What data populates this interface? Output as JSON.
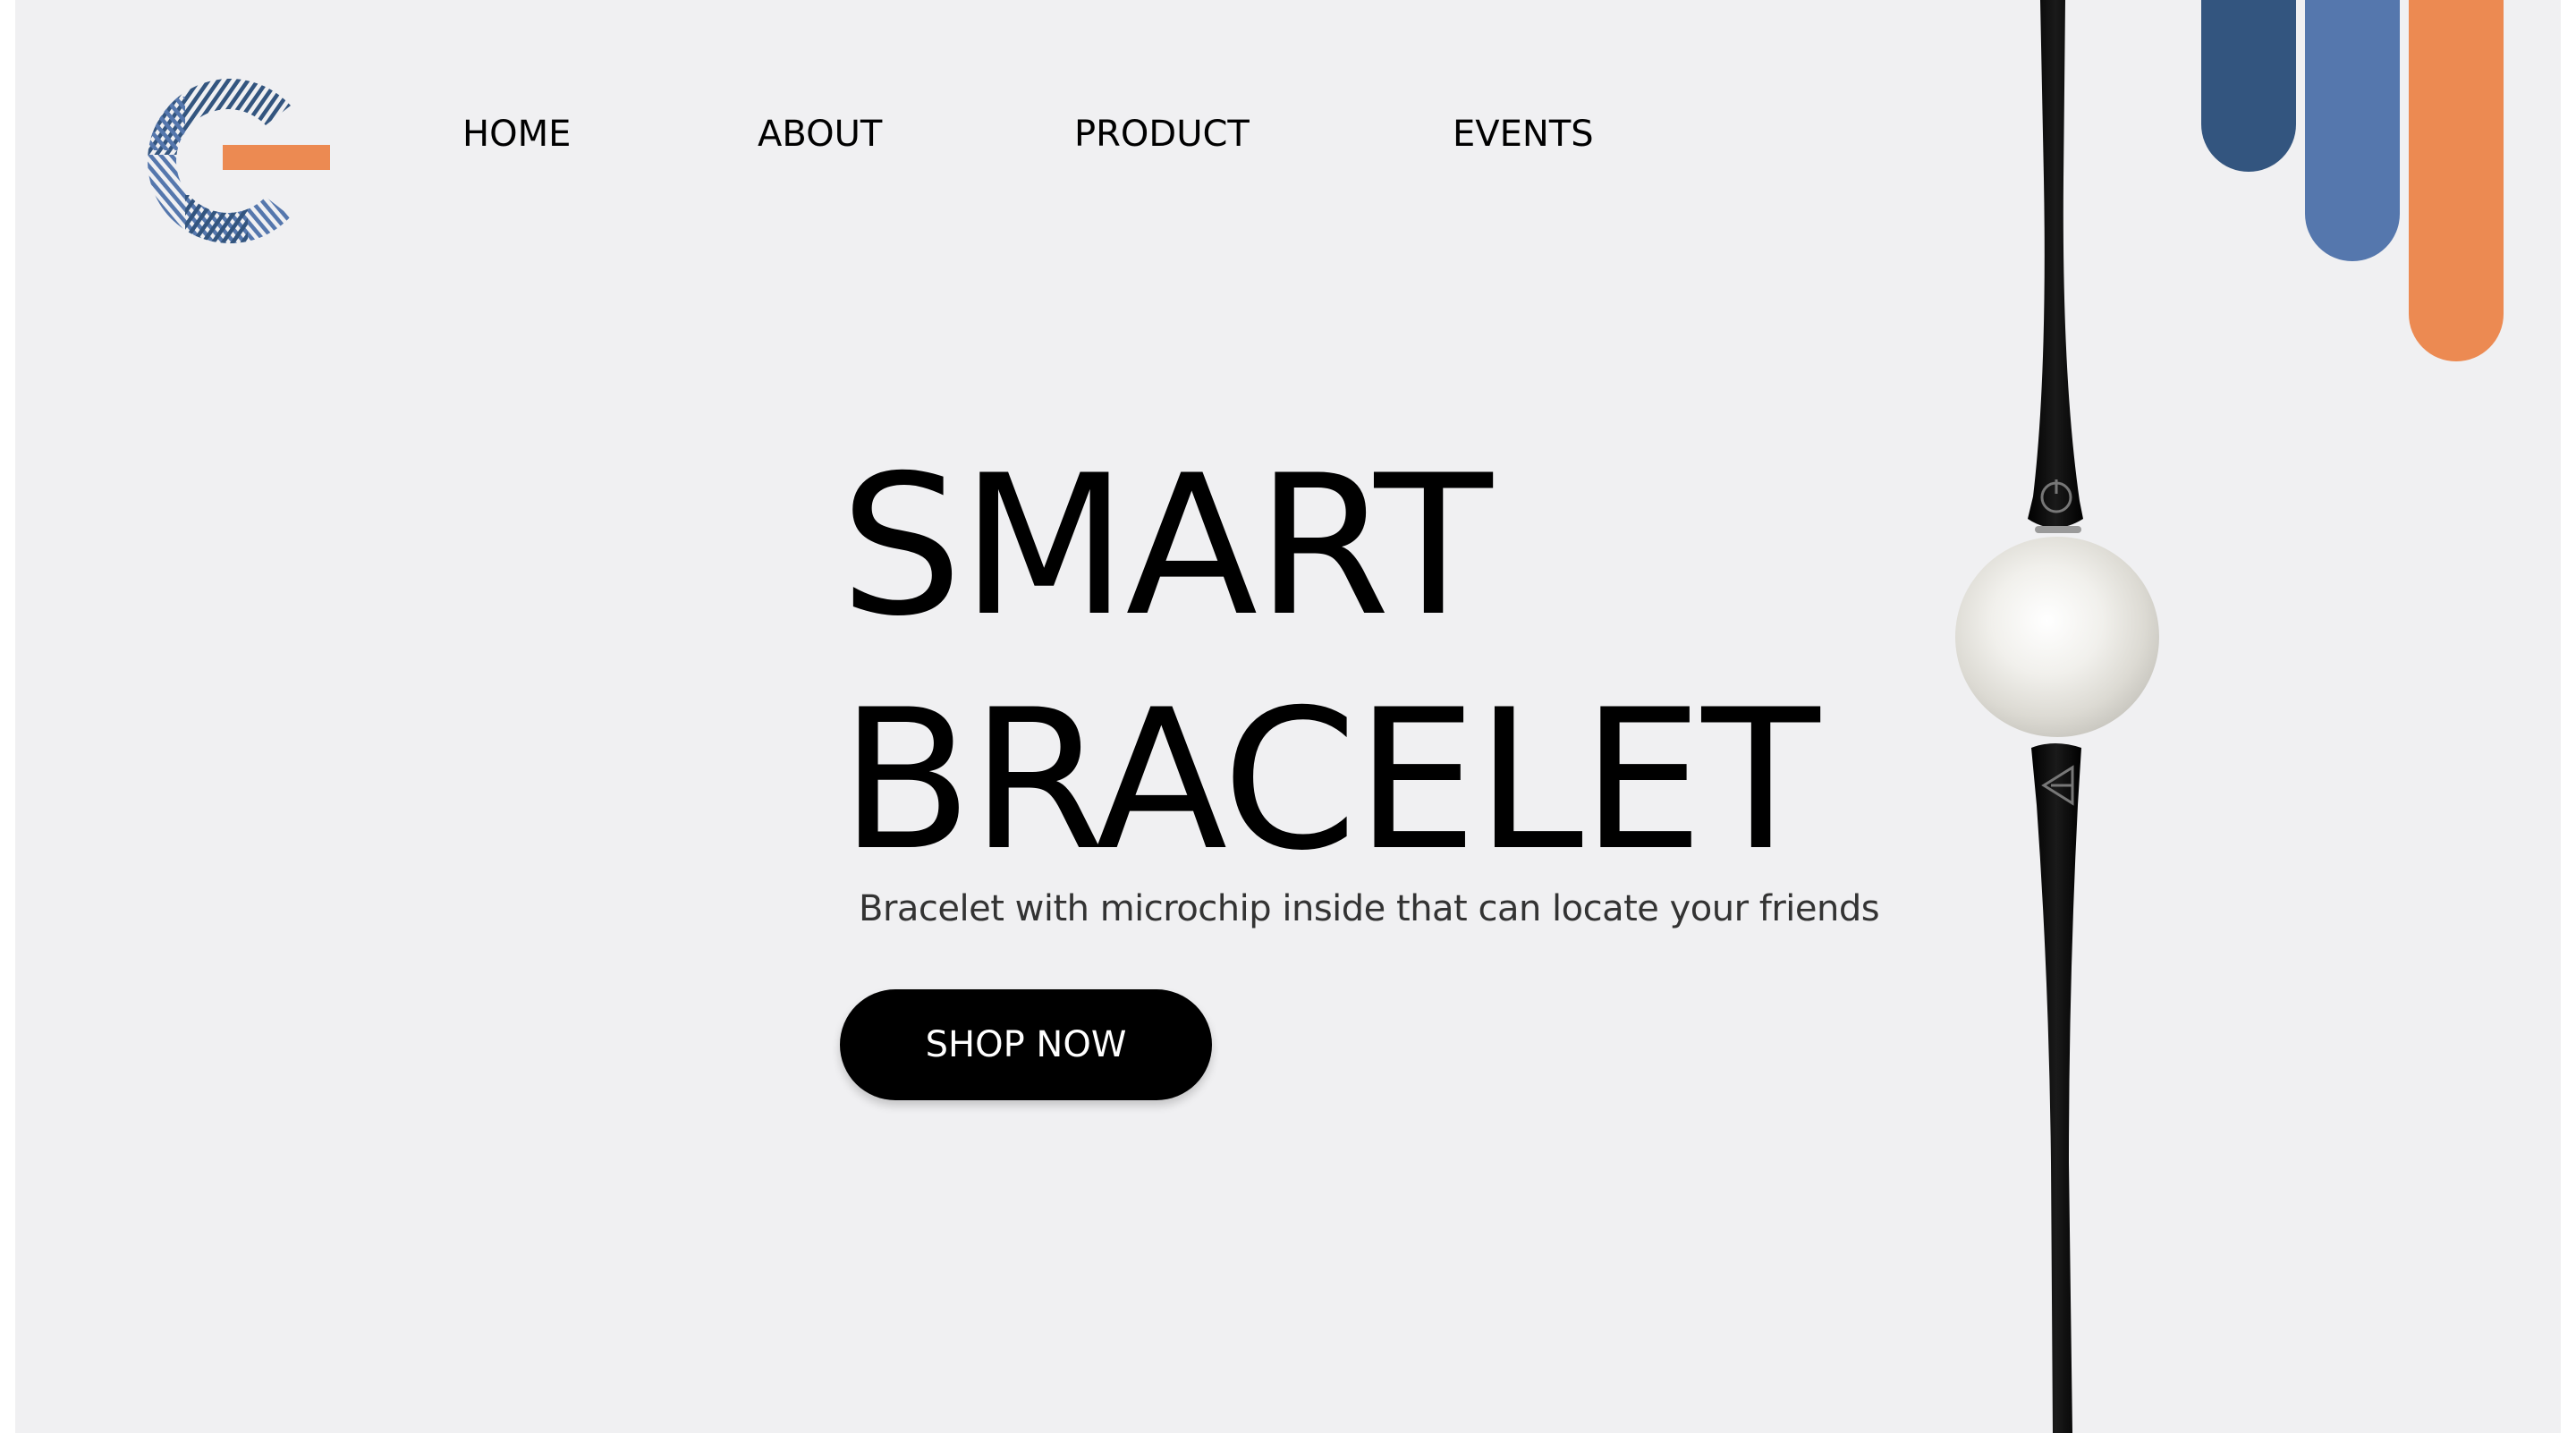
{
  "brand": {
    "logo_name": "G",
    "logo_icon": "striped-g-logo"
  },
  "nav": {
    "items": [
      {
        "label": "HOME"
      },
      {
        "label": "ABOUT"
      },
      {
        "label": "PRODUCT"
      },
      {
        "label": "EVENTS"
      }
    ]
  },
  "hero": {
    "title_line1": "SMART",
    "title_line2": "BRACELET",
    "subtitle": "Bracelet with microchip inside that can locate your friends",
    "cta_label": "SHOP NOW"
  },
  "product_image": {
    "icon": "smart-bracelet-illustration",
    "band_color": "#000000",
    "pearl_color": "#ececE6"
  },
  "colors": {
    "background": "#f0f0f2",
    "navy": "#33557f",
    "blue": "#5577ad",
    "orange": "#ec8a52",
    "text": "#000000",
    "button": "#000000"
  }
}
